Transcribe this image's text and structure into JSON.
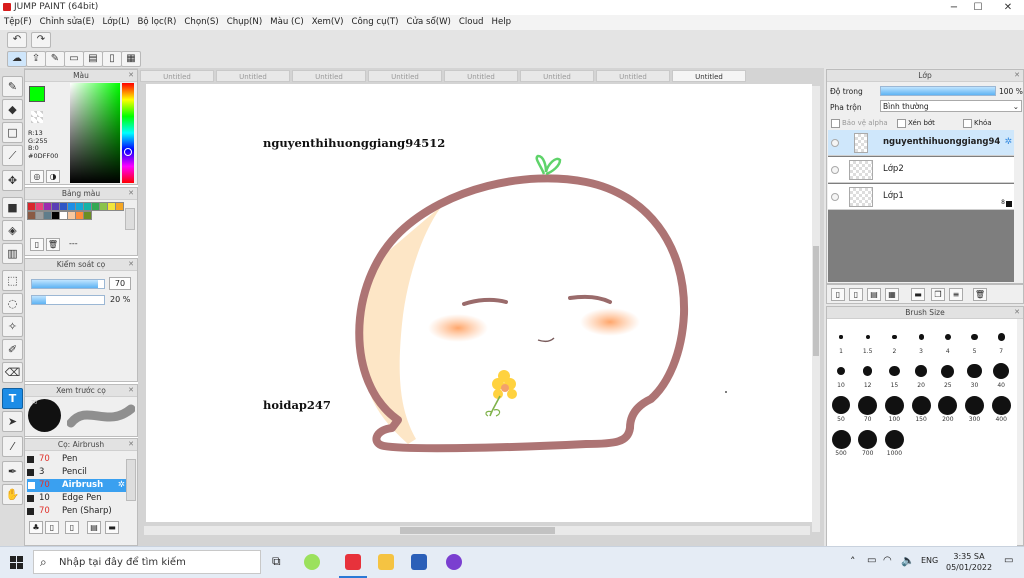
{
  "window": {
    "title": "JUMP PAINT (64bit)",
    "minimize_icon": "−",
    "maximize_icon": "☐",
    "close_icon": "✕"
  },
  "menu": [
    "Tệp(F)",
    "Chỉnh sửa(E)",
    "Lớp(L)",
    "Bộ lọc(R)",
    "Chọn(S)",
    "Chụp(N)",
    "Màu (C)",
    "Xem(V)",
    "Công cụ(T)",
    "Cửa sổ(W)",
    "Cloud",
    "Help"
  ],
  "toolbar": {
    "undo_icon": "↶",
    "redo_icon": "↷"
  },
  "color_panel": {
    "title": "Màu",
    "current_color": "#00FF00",
    "r": "R:13",
    "g": "G:255",
    "b": "B:0",
    "hex": "#0DFF00"
  },
  "palette_panel": {
    "title": "Bảng màu",
    "swatches": [
      "#d9262b",
      "#e8427b",
      "#9b2bb0",
      "#5a3fb6",
      "#2f56c5",
      "#1e8ee6",
      "#16a7d6",
      "#17b3a6",
      "#34a853",
      "#8bc34a",
      "#f2e63a",
      "#f5a623",
      "#8a5a44",
      "#9e9e9e",
      "#607d8b",
      "#000000",
      "#ffffff",
      "#f7c8a0",
      "#ff8c3a",
      "#6b8e23"
    ],
    "more": "---"
  },
  "brush_control": {
    "title": "Kiểm soát cọ",
    "size_value": "70",
    "opacity_value": "20 %",
    "size_fraction": 0.92,
    "opacity_fraction": 0.2
  },
  "preview_panel": {
    "title": "Xem trước cọ",
    "size_label": "70"
  },
  "brush_list": {
    "title": "Cọ: Airbrush",
    "items": [
      {
        "size": "70",
        "name": "Pen"
      },
      {
        "size": "3",
        "name": "Pencil"
      },
      {
        "size": "70",
        "name": "Airbrush"
      },
      {
        "size": "10",
        "name": "Edge Pen"
      },
      {
        "size": "70",
        "name": "Pen (Sharp)"
      }
    ]
  },
  "tabs": [
    "Untitled",
    "Untitled",
    "Untitled",
    "Untitled",
    "Untitled",
    "Untitled",
    "Untitled",
    "Untitled"
  ],
  "canvas": {
    "text1": "nguyenthihuonggiang94512",
    "text2": "hoidap247"
  },
  "layer_panel": {
    "title": "Lớp",
    "opacity_label": "Độ trong",
    "opacity_value": "100 %",
    "opacity_fraction": 1.0,
    "blend_label": "Pha trộn",
    "blend_value": "Bình thường",
    "protect_alpha": "Bảo vệ alpha",
    "clipping": "Xén bớt",
    "lock": "Khóa",
    "layers": [
      {
        "name": "nguyenthihuonggiang94512"
      },
      {
        "name": "Lớp2"
      },
      {
        "name": "Lớp1"
      }
    ],
    "badge": "8"
  },
  "brush_size_panel": {
    "title": "Brush Size",
    "sizes": [
      "1",
      "1.5",
      "2",
      "3",
      "4",
      "5",
      "7",
      "10",
      "12",
      "15",
      "20",
      "25",
      "30",
      "40",
      "50",
      "70",
      "100",
      "150",
      "200",
      "300",
      "400",
      "500",
      "700",
      "1000"
    ]
  },
  "taskbar": {
    "search_placeholder": "Nhập tại đây để tìm kiếm",
    "lang": "ENG",
    "time": "3:35 SA",
    "date": "05/01/2022"
  }
}
